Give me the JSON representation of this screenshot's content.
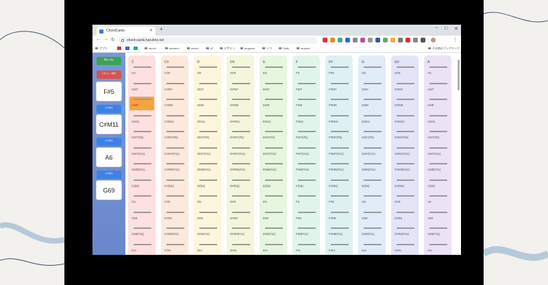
{
  "browser": {
    "tab_title": "ChordCards",
    "url": "chord-cards.haruhiro.net",
    "bookmarks": [
      "アプリ",
      "server",
      "haruhiro",
      "mixed",
      "AT",
      "デザイン",
      "program",
      "いつ",
      "Sails",
      "android"
    ],
    "other_bookmarks": "その他のブックマーク"
  },
  "left_panel": {
    "top_buttons": [
      {
        "label": "再生 / 停止",
        "color": "#3aa357"
      },
      {
        "label": "リセット / 保存",
        "color": "#d9534f"
      }
    ],
    "cards": [
      {
        "chord": "F#5",
        "button": "入れ替え"
      },
      {
        "chord": "C#M11",
        "button": "入れ替え"
      },
      {
        "chord": "A6",
        "button": "入れ替え"
      },
      {
        "chord": "G69",
        "button": ""
      }
    ],
    "button_color": "#3b82e8"
  },
  "columns": [
    {
      "root": "C",
      "color": "#fde0df"
    },
    {
      "root": "C#",
      "color": "#fde9dc"
    },
    {
      "root": "D",
      "color": "#fdf6dc"
    },
    {
      "root": "D#",
      "color": "#f4f6dc"
    },
    {
      "root": "E",
      "color": "#e7f6df"
    },
    {
      "root": "F",
      "color": "#e0f5ea"
    },
    {
      "root": "F#",
      "color": "#ddf1f2"
    },
    {
      "root": "G",
      "color": "#e0ecf8"
    },
    {
      "root": "G#",
      "color": "#e4e4f8"
    },
    {
      "root": "A",
      "color": "#ece2f6"
    }
  ],
  "suffixes": [
    "6",
    "M7",
    "M9",
    "M11",
    "M7(#5)",
    "M7(#11)",
    "M9(#11)",
    "(b5)",
    "5",
    "69",
    "69(#11)",
    "m"
  ],
  "selected": {
    "column": 0,
    "row": 2
  },
  "selected_color": "#f5a53f"
}
